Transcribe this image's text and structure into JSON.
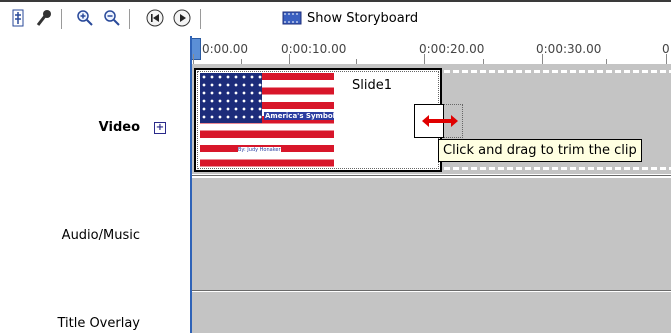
{
  "toolbar": {
    "storyboard_label": "Show Storyboard",
    "icons": [
      "timeline-properties-icon",
      "narrate-icon",
      "zoom-in-icon",
      "zoom-out-icon",
      "rewind-icon",
      "play-icon",
      "storyboard-icon"
    ]
  },
  "ruler": {
    "labels": [
      "0:00.00",
      "0:00:10.00",
      "0:00:20.00",
      "0:00:30.00",
      "0"
    ]
  },
  "tracks": {
    "video_label": "Video",
    "audio_label": "Audio/Music",
    "title_label": "Title Overlay",
    "expand_symbol": "+"
  },
  "clip": {
    "title": "Slide1",
    "flag_title": "America's Symbols",
    "flag_subtitle": "By: Judy Honaker"
  },
  "tooltip": {
    "text": "Click and drag to trim the clip"
  },
  "colors": {
    "track_bg": "#c4c4c4",
    "tooltip_bg": "#ffffe1",
    "accent": "#2f63b8",
    "trim_arrow": "#e00000"
  }
}
